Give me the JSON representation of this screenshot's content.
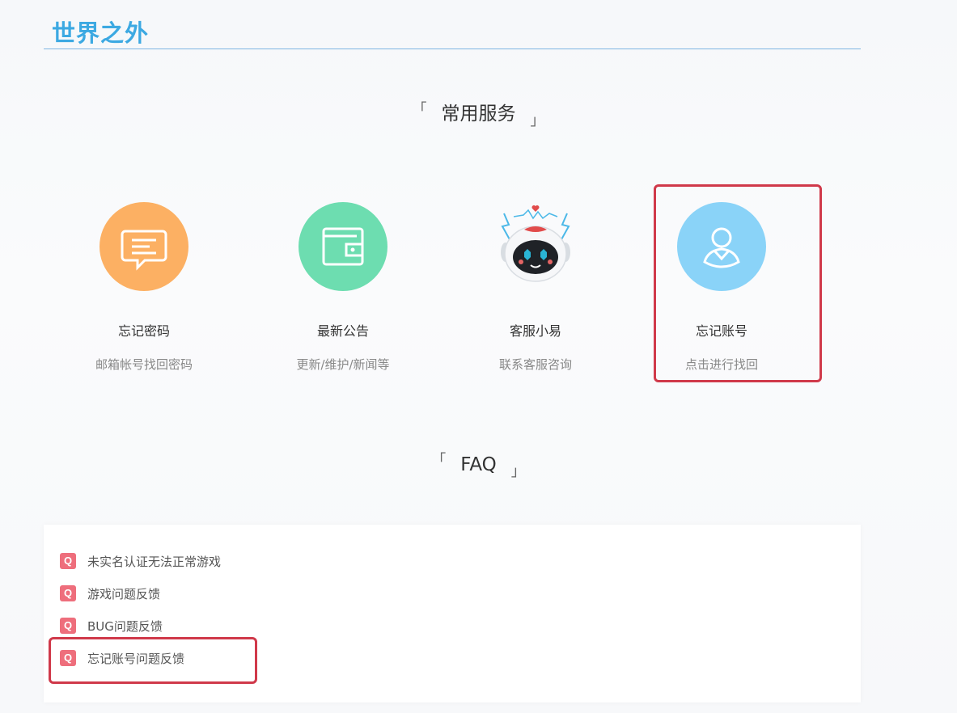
{
  "header": {
    "logo": "世界之外"
  },
  "services_section": {
    "title": "常用服务",
    "bracket_left": "「",
    "bracket_right": "」",
    "items": [
      {
        "name": "忘记密码",
        "desc": "邮箱帐号找回密码",
        "icon": "message-icon",
        "color": "#fcb063"
      },
      {
        "name": "最新公告",
        "desc": "更新/维护/新闻等",
        "icon": "wallet-icon",
        "color": "#6dddb0"
      },
      {
        "name": "客服小易",
        "desc": "联系客服咨询",
        "icon": "robot-mascot-icon",
        "color": "#ffffff"
      },
      {
        "name": "忘记账号",
        "desc": "点击进行找回",
        "icon": "user-icon",
        "color": "#8ad3f8"
      }
    ]
  },
  "faq_section": {
    "title": "FAQ",
    "bracket_left": "「",
    "bracket_right": "」",
    "q_label": "Q",
    "items": [
      "未实名认证无法正常游戏",
      "游戏问题反馈",
      "BUG问题反馈",
      "忘记账号问题反馈"
    ]
  },
  "colors": {
    "highlight": "#d0394a",
    "logo": "#3ca9e2",
    "faq_q": "#ee6e7c"
  }
}
